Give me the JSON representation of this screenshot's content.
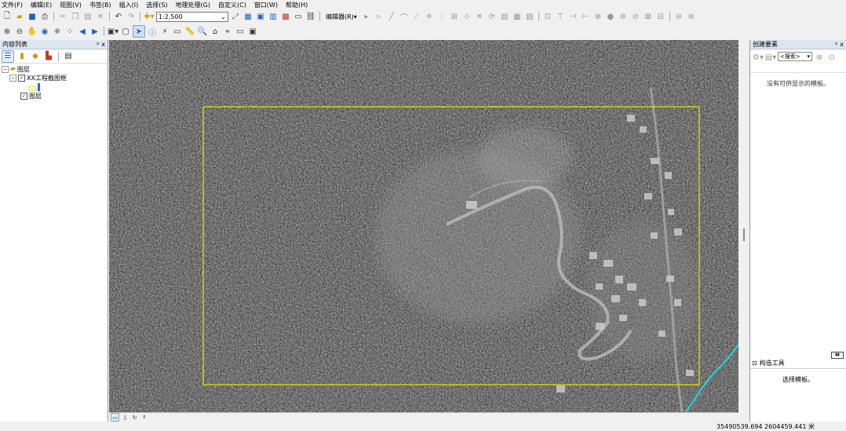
{
  "menu": [
    "文件(F)",
    "编辑(E)",
    "视图(V)",
    "书签(B)",
    "插入(I)",
    "选择(S)",
    "地理处理(G)",
    "自定义(C)",
    "窗口(W)",
    "帮助(H)"
  ],
  "toolbar": {
    "scale_value": "1:2,500",
    "editor_label": "编辑器(R)▾"
  },
  "toc": {
    "title": "内容列表",
    "pin": "ᵖ x",
    "layers_root": "图层",
    "group_layer": "XX工程截图框",
    "sub_layer": "图层"
  },
  "create_features": {
    "title": "创建要素",
    "pin": "ᵖ x",
    "search_placeholder": "<搜索>",
    "empty_message": "没有可供显示的模板。",
    "tools_title": "构造工具",
    "tools_message": "选择模板。"
  },
  "status": {
    "coordinates": "35490539.694  2604459.441 米"
  },
  "colors": {
    "frame": "#e6e600",
    "river": "#1fd4e6",
    "road": "#b9b9b9"
  }
}
